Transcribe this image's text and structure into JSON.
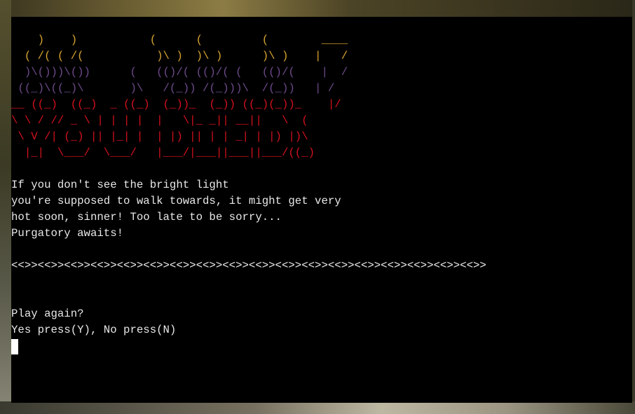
{
  "ascii_art": {
    "lines": [
      {
        "text": "    )    )           (      (         (        ____",
        "color": "#d8a531"
      },
      {
        "text": "  ( /( ( /(           )\\ )  )\\ )      )\\ )    |   /",
        "color": "#d8a531"
      },
      {
        "text": "  )\\()))\\())      (   (()/( (()/( (   (()/(    |  /",
        "color": "#6e4a8c"
      },
      {
        "text": " ((_)\\((_)\\       )\\   /(_)) /(_)))\\  /(_))   | /",
        "color": "#6e4a8c"
      },
      {
        "text": "__ ((_)  ((_)  _ ((_)  (_))_  (_)) ((_)(_))_    |/",
        "color": "#d4121c"
      },
      {
        "text": "\\ \\ / // _ \\ | | | |  |   \\|_ _|| __||   \\  ( ",
        "color": "#d4121c"
      },
      {
        "text": " \\ V /| (_) || |_| |  | |) || | | _| | |) |)\\ ",
        "color": "#d4121c"
      },
      {
        "text": "  |_|  \\___/  \\___/   |___/|___||___||___/((_)",
        "color": "#d4121c"
      }
    ]
  },
  "message": {
    "lines": [
      "If you don't see the bright light",
      "you're supposed to walk towards, it might get very",
      "hot soon, sinner! Too late to be sorry...",
      "Purgatory awaits!"
    ]
  },
  "divider": "<<>><<>><<>><<>><<>><<>><<>><<>><<>><<>><<>><<>><<>><<>><<>><<>><<>><<>>",
  "prompt": {
    "question": "Play again?",
    "options": "Yes press(Y), No press(N)"
  },
  "colors": {
    "terminal_bg": "#000000",
    "text": "#e8e8e8",
    "art_orange": "#d8a531",
    "art_purple": "#6e4a8c",
    "art_red": "#d4121c"
  }
}
